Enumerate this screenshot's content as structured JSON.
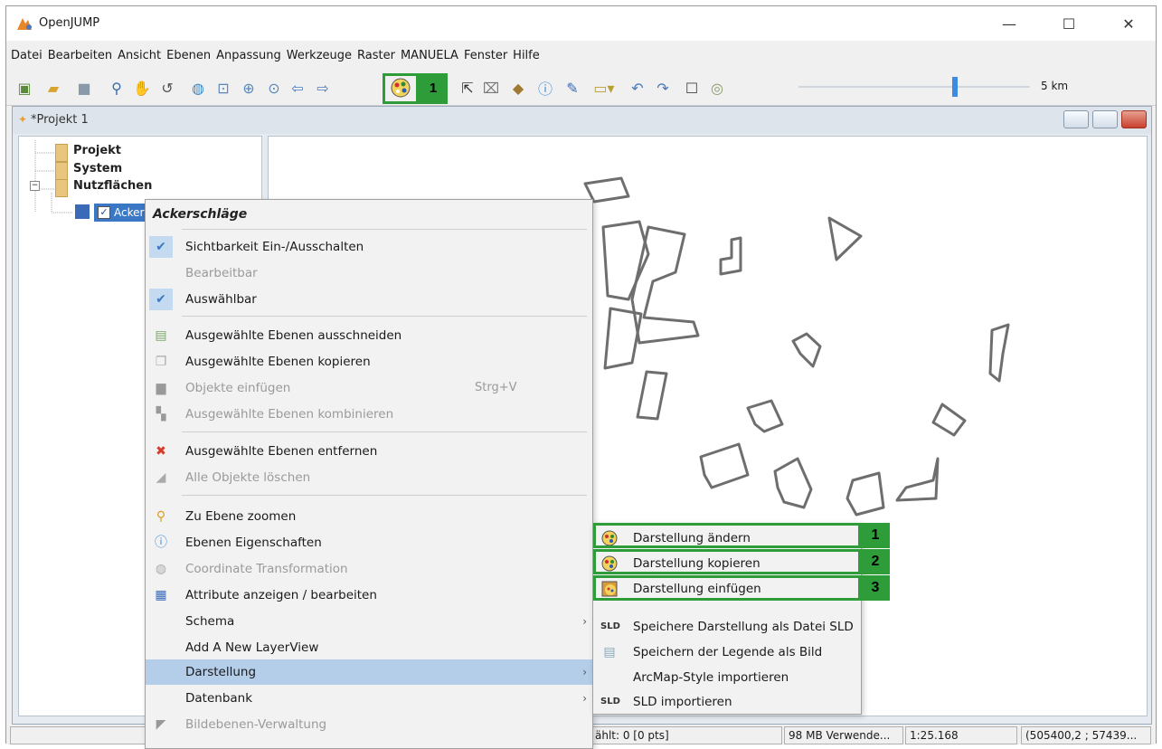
{
  "window": {
    "title": "OpenJUMP",
    "controls": {
      "minimize": "—",
      "maximize": "☐",
      "close": "✕"
    }
  },
  "menubar": [
    "Datei",
    "Bearbeiten",
    "Ansicht",
    "Ebenen",
    "Anpassung",
    "Werkzeuge",
    "Raster",
    "MANUELA",
    "Fenster",
    "Hilfe"
  ],
  "toolbar": {
    "highlight_number": "1",
    "scale_label": "5 km",
    "accent_color": "#2e9c39"
  },
  "frame": {
    "title": "*Projekt 1"
  },
  "tree": {
    "items": [
      "Projekt",
      "System",
      "Nutzflächen"
    ],
    "selected_layer": "Ackers"
  },
  "context_menu": {
    "header": "Ackerschläge",
    "items": [
      {
        "label": "Sichtbarkeit Ein-/Ausschalten",
        "checked": true
      },
      {
        "label": "Bearbeitbar",
        "disabled": true
      },
      {
        "label": "Auswählbar",
        "checked": true
      },
      {
        "label": "Ausgewählte Ebenen ausschneiden",
        "icon": "cut-icon"
      },
      {
        "label": "Ausgewählte Ebenen kopieren",
        "icon": "copy-icon"
      },
      {
        "label": "Objekte einfügen",
        "disabled": true,
        "shortcut": "Strg+V",
        "icon": "paste-icon"
      },
      {
        "label": "Ausgewählte Ebenen kombinieren",
        "disabled": true,
        "icon": "combine-icon"
      },
      {
        "label": "Ausgewählte Ebenen entfernen",
        "icon": "remove-icon"
      },
      {
        "label": "Alle Objekte löschen",
        "disabled": true,
        "icon": "eraser-icon"
      },
      {
        "label": "Zu Ebene zoomen",
        "icon": "zoom-icon"
      },
      {
        "label": "Ebenen Eigenschaften",
        "icon": "info-icon"
      },
      {
        "label": "Coordinate Transformation",
        "disabled": true,
        "icon": "globe-icon"
      },
      {
        "label": "Attribute anzeigen / bearbeiten",
        "icon": "table-icon"
      },
      {
        "label": "Schema",
        "submenu": true
      },
      {
        "label": "Add A New LayerView"
      },
      {
        "label": "Darstellung",
        "submenu": true,
        "active": true
      },
      {
        "label": "Datenbank",
        "submenu": true
      },
      {
        "label": "Bildebenen-Verwaltung",
        "disabled": true,
        "icon": "image-layer-icon"
      }
    ]
  },
  "submenu": {
    "items": [
      {
        "label": "Darstellung ändern",
        "number": "1"
      },
      {
        "label": "Darstellung kopieren",
        "number": "2"
      },
      {
        "label": "Darstellung einfügen",
        "number": "3"
      },
      {
        "label": "Speichere Darstellung als Datei SLD",
        "icon_text": "SLD"
      },
      {
        "label": "Speichern der Legende als Bild"
      },
      {
        "label": "ArcMap-Style importieren"
      },
      {
        "label": "SLD importieren",
        "icon_text": "SLD"
      }
    ]
  },
  "status": {
    "selected": "ählt: 0 [0 pts]",
    "memory": "98 MB Verwende...",
    "scale": "1:25.168",
    "coords": "(505400,2 ; 57439..."
  }
}
